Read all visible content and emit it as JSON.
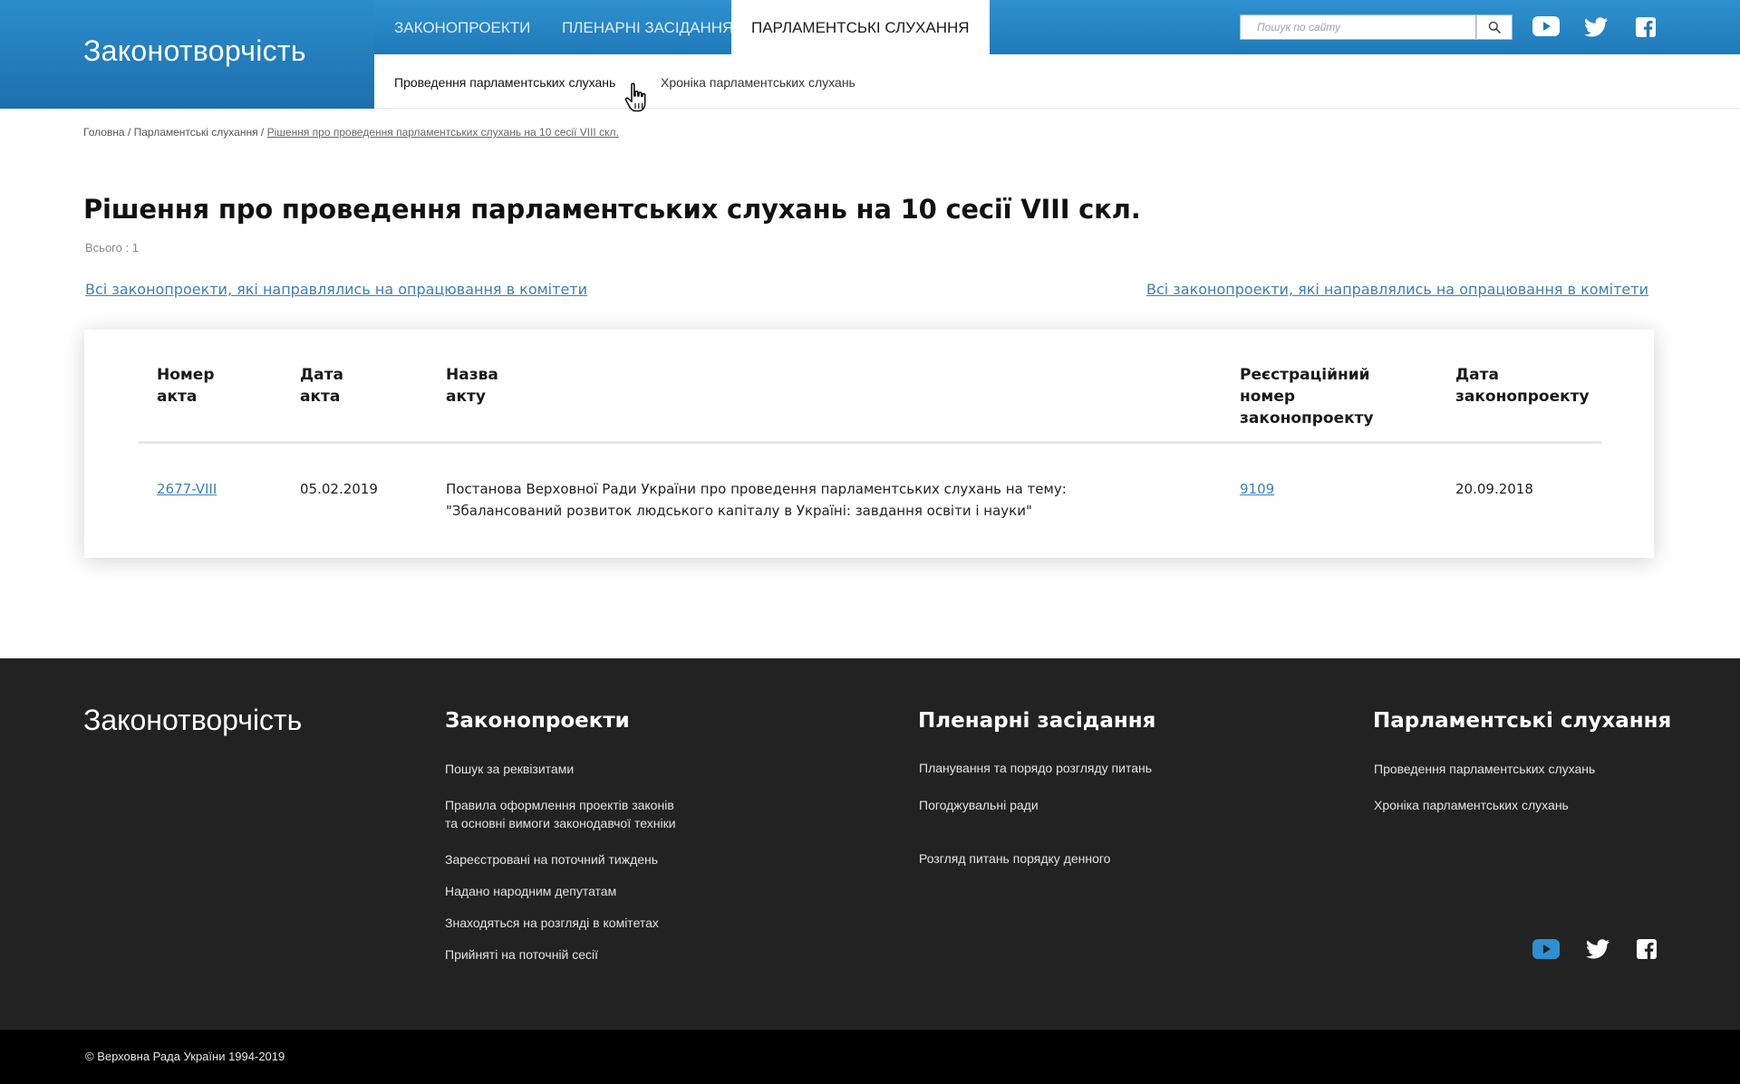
{
  "site": {
    "logo": "Законотворчість"
  },
  "nav": {
    "tabs": [
      {
        "label": "Законопроекти"
      },
      {
        "label": "Пленарні засідання"
      },
      {
        "label": "Парламентські слухання"
      }
    ],
    "active_tab": "Парламентські слухання",
    "search_placeholder": "Пошук по сайту",
    "subtabs": [
      {
        "label": "Проведення парламентських слухань"
      },
      {
        "label": "Хроніка парламентських слухань"
      }
    ]
  },
  "breadcrumb": {
    "items": [
      {
        "label": "Головна"
      },
      {
        "label": "Парламентські слухання"
      },
      {
        "label": "Рішення про проведення парламентських слухань на 10 сесії VIII скл."
      }
    ],
    "separator": "/"
  },
  "main": {
    "title": "Рішення про проведення парламентських слухань на 10 сесії VIII скл.",
    "total": "Всього : 1",
    "link_left": "Всі законопроекти, які направлялись на опрацювання в комітети",
    "link_right": "Всі законопроекти, які направлялись на опрацювання в комітети"
  },
  "table": {
    "headers": [
      {
        "line1": "Номер",
        "line2": "акта",
        "line3": ""
      },
      {
        "line1": "Дата",
        "line2": "акта",
        "line3": ""
      },
      {
        "line1": "Назва",
        "line2": "акту",
        "line3": ""
      },
      {
        "line1": "Реєстраційний",
        "line2": "номер",
        "line3": "законопроекту"
      },
      {
        "line1": "Дата",
        "line2": "законопроекту",
        "line3": ""
      }
    ],
    "rows": [
      {
        "act_number": "2677-VIII",
        "act_date": "05.02.2019",
        "title_line1": "Постанова Верховної Ради України про проведення парламентських слухань на тему:",
        "title_line2": "\"Збалансований розвиток людського капіталу в Україні: завдання освіти і науки\"",
        "reg_number": "9109",
        "bill_date": "20.09.2018"
      }
    ]
  },
  "footer": {
    "logo": "Законотворчість",
    "columns": [
      {
        "title": "Законопроекти",
        "links": [
          "Пошук за реквізитами",
          "Правила оформлення проектів законів",
          "та основні вимоги законодавчої техніки",
          "Зареєстровані на поточний тиждень",
          "Надано народним депутатам",
          "Знаходяться на розгляді в комітетах",
          "Прийняті на поточній сесії"
        ]
      },
      {
        "title": "Пленарні засідання",
        "links": [
          "Планування та порядо розгляду питань",
          "Погоджувальні ради",
          "Розгляд питань порядку денного"
        ]
      },
      {
        "title": "Парламентські слухання",
        "links": [
          "Проведення парламентських слухань",
          "Хроніка парламентських слухань"
        ]
      }
    ],
    "copyright": "© Верховна Рада України 1994-2019"
  },
  "icons": [
    "youtube-icon",
    "twitter-icon",
    "facebook-icon",
    "search-icon",
    "hand-pointer-cursor-icon"
  ],
  "colors": {
    "header_blue": "#2c8dcc",
    "link_blue": "#3c7fb6",
    "footer_bg": "#222222",
    "bottom_bar": "#000000",
    "social_footer_youtube": "#2f8fd0"
  }
}
